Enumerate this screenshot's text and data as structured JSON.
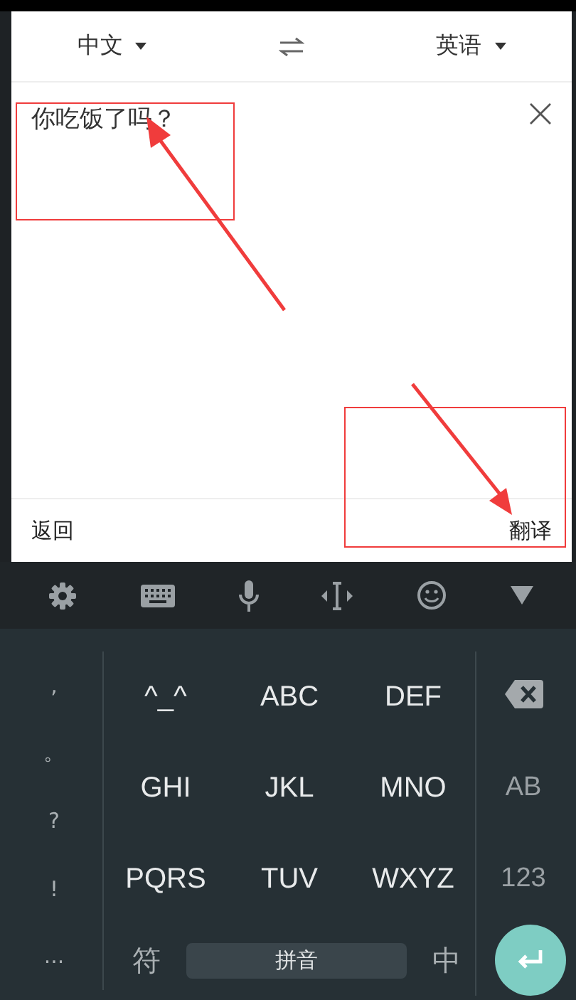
{
  "header": {
    "source_language": "中文",
    "target_language": "英语"
  },
  "input": {
    "value": "你吃饭了吗？"
  },
  "bottom_bar": {
    "back": "返回",
    "translate": "翻译"
  },
  "keyboard": {
    "symbols": [
      ",",
      "。",
      "?",
      "!",
      "..."
    ],
    "keys": [
      "^_^",
      "ABC",
      "DEF",
      "GHI",
      "JKL",
      "MNO",
      "PQRS",
      "TUV",
      "WXYZ"
    ],
    "side_keys": [
      "AB",
      "123"
    ],
    "bottom": {
      "symbol_key": "符",
      "space": "拼音",
      "language_key": "中"
    }
  },
  "annotations": [
    {
      "kind": "box"
    },
    {
      "kind": "box"
    }
  ]
}
